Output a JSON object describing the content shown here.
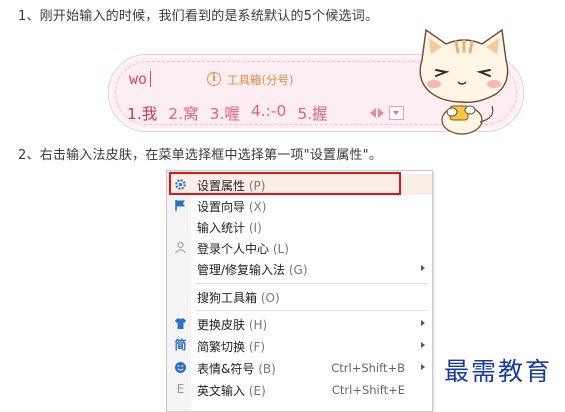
{
  "steps": {
    "step1": "1、刚开始输入的时候，我们看到的是系统默认的5个候选词。",
    "step2": "2、右击输入法皮肤，在菜单选择框中选择第一项\"设置属性\"。"
  },
  "ime": {
    "input_text": "wo",
    "hint_text": "工具箱(分号)",
    "candidates": [
      "1.我",
      "2.窝",
      "3.喔",
      "4.:-0",
      "5.握"
    ],
    "colors": {
      "skin_bg": "#fdeef3",
      "candidate": "#e0627f"
    }
  },
  "menu": {
    "items": [
      {
        "icon": "gear-icon",
        "label": "设置属性",
        "key": "(P)",
        "shortcut": "",
        "submenu": false
      },
      {
        "icon": "flag-icon",
        "label": "设置向导",
        "key": "(X)",
        "shortcut": "",
        "submenu": false
      },
      {
        "icon": "",
        "label": "输入统计",
        "key": "(I)",
        "shortcut": "",
        "submenu": false
      },
      {
        "icon": "user-icon",
        "label": "登录个人中心",
        "key": "(L)",
        "shortcut": "",
        "submenu": false
      },
      {
        "icon": "",
        "label": "管理/修复输入法",
        "key": "(G)",
        "shortcut": "",
        "submenu": true
      },
      {
        "icon": "",
        "label": "搜狗工具箱",
        "key": "(O)",
        "shortcut": "",
        "submenu": false
      },
      {
        "icon": "shirt-icon",
        "label": "更换皮肤",
        "key": "(H)",
        "shortcut": "",
        "submenu": true
      },
      {
        "icon": "simplified-icon",
        "label": "简繁切换",
        "key": "(F)",
        "shortcut": "",
        "submenu": true
      },
      {
        "icon": "smiley-icon",
        "label": "表情&符号",
        "key": "(B)",
        "shortcut": "Ctrl+Shift+B",
        "submenu": true
      },
      {
        "icon": "english-icon",
        "label": "英文输入",
        "key": "(E)",
        "shortcut": "Ctrl+Shift+E",
        "submenu": false
      }
    ],
    "icon_glyphs": {
      "simplified": "简",
      "english": "E"
    },
    "highlight_color": "#e0141b"
  },
  "watermark": {
    "text": "最需教育"
  }
}
